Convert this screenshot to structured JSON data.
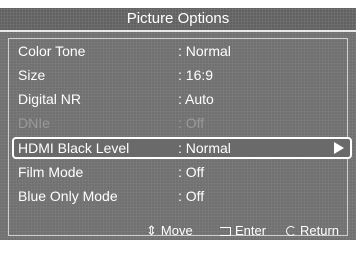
{
  "menu": {
    "title": "Picture Options",
    "items": [
      {
        "label": "Color Tone",
        "value": ": Normal",
        "state": "normal"
      },
      {
        "label": "Size",
        "value": ": 16:9",
        "state": "normal"
      },
      {
        "label": "Digital NR",
        "value": ": Auto",
        "state": "normal"
      },
      {
        "label": "DNIe",
        "value": ": Off",
        "state": "disabled"
      },
      {
        "label": "HDMI Black Level",
        "value": ": Normal",
        "state": "selected"
      },
      {
        "label": "Film Mode",
        "value": ": Off",
        "state": "normal"
      },
      {
        "label": "Blue Only Mode",
        "value": ": Off",
        "state": "normal"
      }
    ]
  },
  "footer": {
    "move_glyph": "⇕",
    "move_label": "Move",
    "enter_label": "Enter",
    "return_label": "Return"
  },
  "icons": {
    "selected_arrow": "right-arrow-icon",
    "move": "up-down-arrow-icon",
    "enter": "enter-icon",
    "return": "return-icon"
  },
  "colors": {
    "panel": "#6e6e6e",
    "text": "#ffffff",
    "disabled_text": "#9a9a9a",
    "highlight_border": "#ffffff"
  }
}
